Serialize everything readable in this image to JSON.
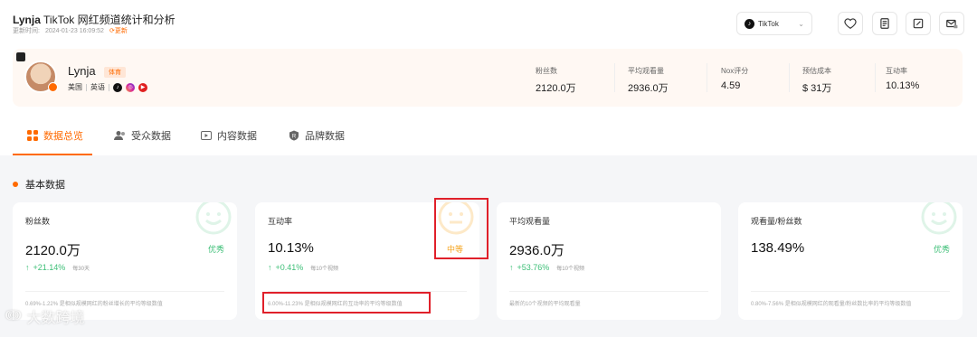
{
  "header": {
    "creator_name": "Lynja",
    "title_rest": "TikTok 网红频道统计和分析",
    "updated_label": "更新时间:",
    "updated_time": "2024-01-23 16:09:52",
    "refresh_label": "⟳更新",
    "platform_label": "TikTok"
  },
  "profile": {
    "name": "Lynja",
    "category_tag": "体育",
    "country": "美国",
    "language": "英语",
    "socials": [
      "tiktok-icon",
      "instagram-icon",
      "youtube-icon"
    ],
    "stats": [
      {
        "label": "粉丝数",
        "value": "2120.0万"
      },
      {
        "label": "平均观看量",
        "value": "2936.0万"
      },
      {
        "label": "Nox评分",
        "value": "4.59"
      },
      {
        "label": "预估成本",
        "value": "$ 31万"
      },
      {
        "label": "互动率",
        "value": "10.13%"
      }
    ]
  },
  "tabs": [
    {
      "label": "数据总览",
      "icon": "grid-icon",
      "active": true
    },
    {
      "label": "受众数据",
      "icon": "users-icon",
      "active": false
    },
    {
      "label": "内容数据",
      "icon": "video-icon",
      "active": false
    },
    {
      "label": "品牌数据",
      "icon": "brand-icon",
      "active": false
    }
  ],
  "section_title": "基本数据",
  "cards": [
    {
      "label": "粉丝数",
      "value": "2120.0万",
      "grade": "优秀",
      "grade_color": "#3dbf77",
      "change": "+21.14%",
      "period": "每30天",
      "footnote": "0.69%-1.22% 是相似规模网红的粉丝增长的平均等级数值"
    },
    {
      "label": "互动率",
      "value": "10.13%",
      "grade": "中等",
      "grade_color": "#f5a623",
      "change": "+0.41%",
      "period": "每10个视频",
      "footnote": "6.00%-11.23% 是相似规模网红的互动率的平均等级数值"
    },
    {
      "label": "平均观看量",
      "value": "2936.0万",
      "grade": "",
      "grade_color": "#3dbf77",
      "change": "+53.76%",
      "period": "每10个视频",
      "footnote": "最新的10个视频的平均观看量"
    },
    {
      "label": "观看量/粉丝数",
      "value": "138.49%",
      "grade": "优秀",
      "grade_color": "#3dbf77",
      "change": "",
      "period": "",
      "footnote": "0.80%-7.56% 是相似规模网红的观看量/粉丝数比率的平均等级数值"
    }
  ],
  "watermark": "大数跨境",
  "colors": {
    "accent": "#ff6a00",
    "good": "#3dbf77",
    "medium": "#f5a623",
    "highlight_box": "#e0202a"
  }
}
